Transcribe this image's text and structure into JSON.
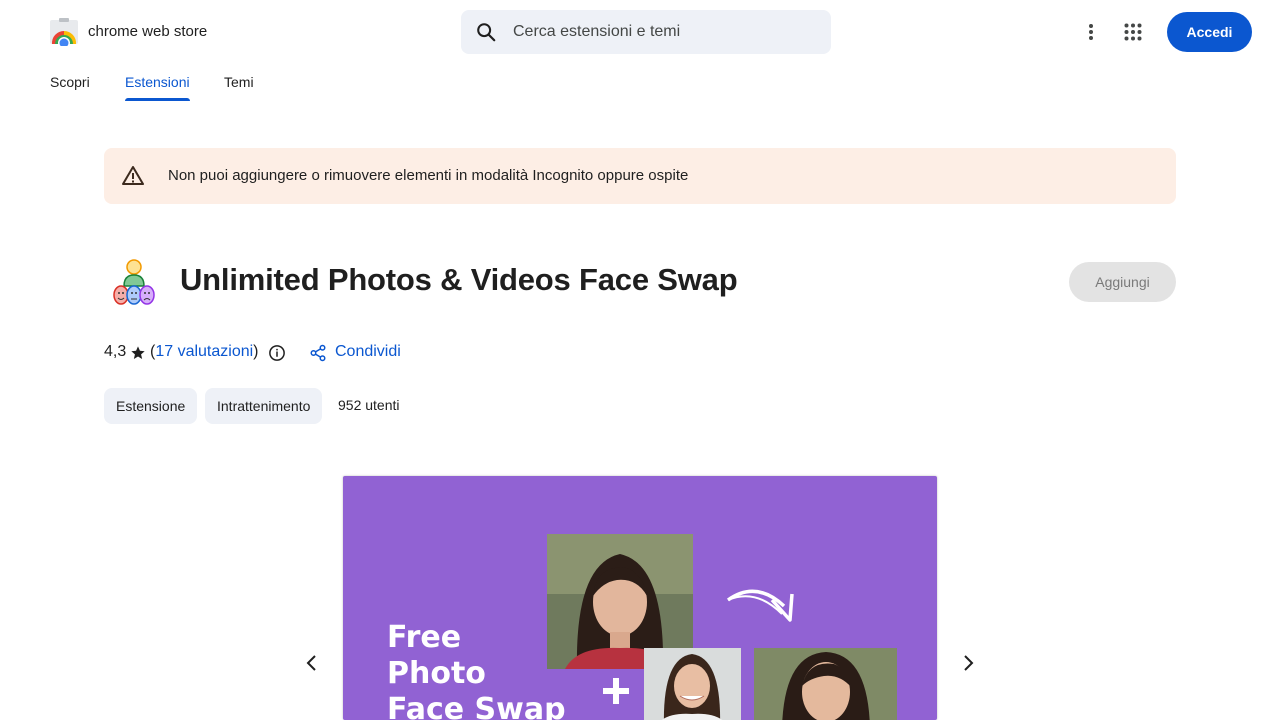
{
  "header": {
    "logo_text": "chrome web store",
    "search_placeholder": "Cerca estensioni e temi",
    "signin_label": "Accedi"
  },
  "tabs": [
    {
      "label": "Scopri",
      "active": false
    },
    {
      "label": "Estensioni",
      "active": true
    },
    {
      "label": "Temi",
      "active": false
    }
  ],
  "banner": {
    "text": "Non puoi aggiungere o rimuovere elementi in modalità Incognito oppure ospite"
  },
  "extension": {
    "title": "Unlimited Photos & Videos Face Swap",
    "add_label": "Aggiungi",
    "rating": "4,3",
    "reviews_open": "(",
    "reviews_link": "17 valutazioni",
    "reviews_close": ")",
    "share_label": "Condividi",
    "chips": [
      "Estensione",
      "Intrattenimento"
    ],
    "users": "952 utenti"
  },
  "carousel": {
    "slide_text": [
      "Free",
      "Photo",
      "Face Swap"
    ]
  },
  "colors": {
    "accent": "#0b57d0",
    "banner_bg": "#fdeee5",
    "slide_bg": "#9162d3",
    "chip_bg": "#eef1f7"
  }
}
